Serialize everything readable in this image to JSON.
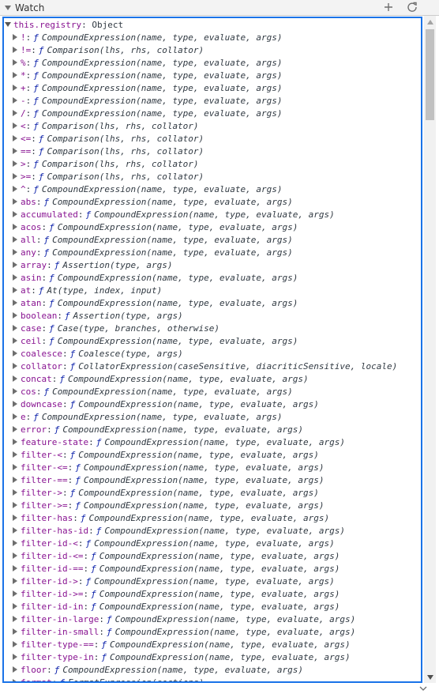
{
  "panel": {
    "title": "Watch",
    "add_icon": "plus-icon",
    "refresh_icon": "refresh-icon"
  },
  "root": {
    "expression": "this.registry",
    "value": "Object"
  },
  "entries": [
    {
      "key": "!",
      "sig": "CompoundExpression(name, type, evaluate, args)"
    },
    {
      "key": "!=",
      "sig": "Comparison(lhs, rhs, collator)"
    },
    {
      "key": "%",
      "sig": "CompoundExpression(name, type, evaluate, args)"
    },
    {
      "key": "*",
      "sig": "CompoundExpression(name, type, evaluate, args)"
    },
    {
      "key": "+",
      "sig": "CompoundExpression(name, type, evaluate, args)"
    },
    {
      "key": "-",
      "sig": "CompoundExpression(name, type, evaluate, args)"
    },
    {
      "key": "/",
      "sig": "CompoundExpression(name, type, evaluate, args)"
    },
    {
      "key": "<",
      "sig": "Comparison(lhs, rhs, collator)"
    },
    {
      "key": "<=",
      "sig": "Comparison(lhs, rhs, collator)"
    },
    {
      "key": "==",
      "sig": "Comparison(lhs, rhs, collator)"
    },
    {
      "key": ">",
      "sig": "Comparison(lhs, rhs, collator)"
    },
    {
      "key": ">=",
      "sig": "Comparison(lhs, rhs, collator)"
    },
    {
      "key": "^",
      "sig": "CompoundExpression(name, type, evaluate, args)"
    },
    {
      "key": "abs",
      "sig": "CompoundExpression(name, type, evaluate, args)"
    },
    {
      "key": "accumulated",
      "sig": "CompoundExpression(name, type, evaluate, args)"
    },
    {
      "key": "acos",
      "sig": "CompoundExpression(name, type, evaluate, args)"
    },
    {
      "key": "all",
      "sig": "CompoundExpression(name, type, evaluate, args)"
    },
    {
      "key": "any",
      "sig": "CompoundExpression(name, type, evaluate, args)"
    },
    {
      "key": "array",
      "sig": "Assertion(type, args)"
    },
    {
      "key": "asin",
      "sig": "CompoundExpression(name, type, evaluate, args)"
    },
    {
      "key": "at",
      "sig": "At(type, index, input)"
    },
    {
      "key": "atan",
      "sig": "CompoundExpression(name, type, evaluate, args)"
    },
    {
      "key": "boolean",
      "sig": "Assertion(type, args)"
    },
    {
      "key": "case",
      "sig": "Case(type, branches, otherwise)"
    },
    {
      "key": "ceil",
      "sig": "CompoundExpression(name, type, evaluate, args)"
    },
    {
      "key": "coalesce",
      "sig": "Coalesce(type, args)"
    },
    {
      "key": "collator",
      "sig": "CollatorExpression(caseSensitive, diacriticSensitive, locale)"
    },
    {
      "key": "concat",
      "sig": "CompoundExpression(name, type, evaluate, args)"
    },
    {
      "key": "cos",
      "sig": "CompoundExpression(name, type, evaluate, args)"
    },
    {
      "key": "downcase",
      "sig": "CompoundExpression(name, type, evaluate, args)"
    },
    {
      "key": "e",
      "sig": "CompoundExpression(name, type, evaluate, args)"
    },
    {
      "key": "error",
      "sig": "CompoundExpression(name, type, evaluate, args)"
    },
    {
      "key": "feature-state",
      "sig": "CompoundExpression(name, type, evaluate, args)"
    },
    {
      "key": "filter-<",
      "sig": "CompoundExpression(name, type, evaluate, args)"
    },
    {
      "key": "filter-<=",
      "sig": "CompoundExpression(name, type, evaluate, args)"
    },
    {
      "key": "filter-==",
      "sig": "CompoundExpression(name, type, evaluate, args)"
    },
    {
      "key": "filter->",
      "sig": "CompoundExpression(name, type, evaluate, args)"
    },
    {
      "key": "filter->=",
      "sig": "CompoundExpression(name, type, evaluate, args)"
    },
    {
      "key": "filter-has",
      "sig": "CompoundExpression(name, type, evaluate, args)"
    },
    {
      "key": "filter-has-id",
      "sig": "CompoundExpression(name, type, evaluate, args)"
    },
    {
      "key": "filter-id-<",
      "sig": "CompoundExpression(name, type, evaluate, args)"
    },
    {
      "key": "filter-id-<=",
      "sig": "CompoundExpression(name, type, evaluate, args)"
    },
    {
      "key": "filter-id-==",
      "sig": "CompoundExpression(name, type, evaluate, args)"
    },
    {
      "key": "filter-id->",
      "sig": "CompoundExpression(name, type, evaluate, args)"
    },
    {
      "key": "filter-id->=",
      "sig": "CompoundExpression(name, type, evaluate, args)"
    },
    {
      "key": "filter-id-in",
      "sig": "CompoundExpression(name, type, evaluate, args)"
    },
    {
      "key": "filter-in-large",
      "sig": "CompoundExpression(name, type, evaluate, args)"
    },
    {
      "key": "filter-in-small",
      "sig": "CompoundExpression(name, type, evaluate, args)"
    },
    {
      "key": "filter-type-==",
      "sig": "CompoundExpression(name, type, evaluate, args)"
    },
    {
      "key": "filter-type-in",
      "sig": "CompoundExpression(name, type, evaluate, args)"
    },
    {
      "key": "floor",
      "sig": "CompoundExpression(name, type, evaluate, args)"
    },
    {
      "key": "format",
      "sig": "FormatExpression(sections)"
    }
  ],
  "labels": {
    "colon": ":",
    "function_symbol": "ƒ"
  },
  "colors": {
    "focus_border": "#1a73e8",
    "key_color": "#881391",
    "function_symbol_color": "#0d22aa",
    "text_color": "#303942"
  }
}
